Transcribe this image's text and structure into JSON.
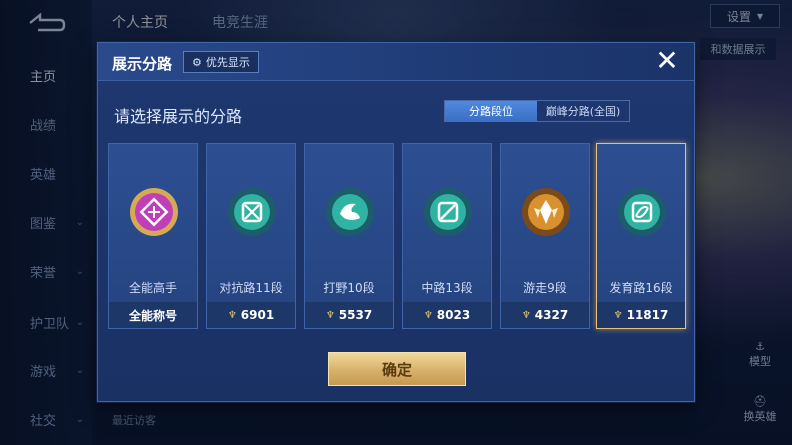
{
  "background": {
    "top_tabs": [
      "个人主页",
      "电竞生涯"
    ],
    "settings_label": "设置",
    "side_nav": [
      {
        "label": "主页",
        "active": true
      },
      {
        "label": "战绩"
      },
      {
        "label": "英雄"
      },
      {
        "label": "图鉴"
      },
      {
        "label": "荣誉"
      },
      {
        "label": "护卫队"
      },
      {
        "label": "游戏"
      },
      {
        "label": "社交"
      }
    ],
    "data_chip": "和数据展示",
    "recent_visitors": "最近访客",
    "tool_model": "模型",
    "tool_change_hero": "换英雄"
  },
  "dialog": {
    "title": "展示分路",
    "priority_label": "优先显示",
    "prompt": "请选择展示的分路",
    "toggle": {
      "options": [
        "分路段位",
        "巅峰分路(全国)"
      ],
      "active": 0
    },
    "cards": [
      {
        "label": "全能高手",
        "footer": "全能称号",
        "emblem_color": "#c03fb8",
        "selected": false
      },
      {
        "label": "对抗路11段",
        "footer": "6901",
        "emblem_color": "#2fb3a2",
        "selected": false
      },
      {
        "label": "打野10段",
        "footer": "5537",
        "emblem_color": "#2fb3a2",
        "selected": false
      },
      {
        "label": "中路13段",
        "footer": "8023",
        "emblem_color": "#2fb3a2",
        "selected": false
      },
      {
        "label": "游走9段",
        "footer": "4327",
        "emblem_color": "#d9912f",
        "selected": false
      },
      {
        "label": "发育路16段",
        "footer": "11817",
        "emblem_color": "#2fb3a2",
        "selected": true
      }
    ],
    "confirm_label": "确定",
    "colors": {
      "gold": "#e7c178",
      "panel": "#1e3870",
      "accent_blue": "#4f8ae0"
    }
  }
}
